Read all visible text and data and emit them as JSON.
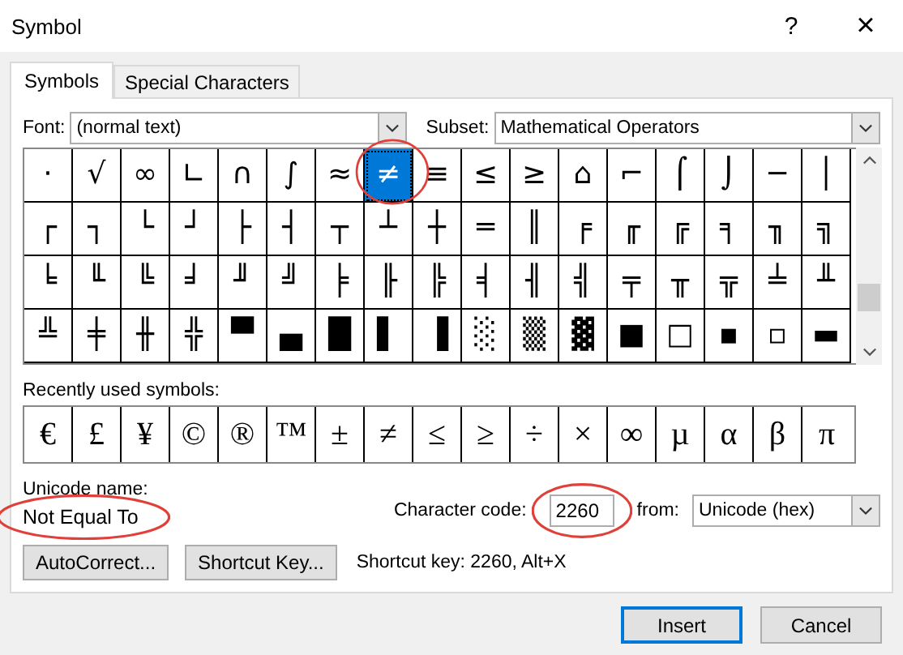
{
  "window": {
    "title": "Symbol",
    "help_button": "?",
    "close_button": "×"
  },
  "tabs": [
    {
      "label": "Symbols",
      "selected": true
    },
    {
      "label": "Special Characters",
      "selected": false
    }
  ],
  "font": {
    "label": "Font:",
    "value": "(normal text)"
  },
  "subset": {
    "label": "Subset:",
    "value": "Mathematical Operators"
  },
  "symbol_grid": [
    [
      {
        "char": "·",
        "selected": false
      },
      {
        "char": "√",
        "selected": false
      },
      {
        "char": "∞",
        "selected": false
      },
      {
        "char": "∟",
        "selected": false
      },
      {
        "char": "∩",
        "selected": false
      },
      {
        "char": "∫",
        "selected": false
      },
      {
        "char": "≈",
        "selected": false
      },
      {
        "char": "≠",
        "selected": true
      },
      {
        "char": "≡",
        "selected": false
      },
      {
        "char": "≤",
        "selected": false
      },
      {
        "char": "≥",
        "selected": false
      },
      {
        "char": "⌂",
        "selected": false
      },
      {
        "char": "⌐",
        "selected": false
      },
      {
        "char": "⌠",
        "selected": false
      },
      {
        "char": "⌡",
        "selected": false
      },
      {
        "char": "─",
        "selected": false
      },
      {
        "char": "│",
        "selected": false
      }
    ],
    [
      {
        "char": "┌",
        "selected": false
      },
      {
        "char": "┐",
        "selected": false
      },
      {
        "char": "└",
        "selected": false
      },
      {
        "char": "┘",
        "selected": false
      },
      {
        "char": "├",
        "selected": false
      },
      {
        "char": "┤",
        "selected": false
      },
      {
        "char": "┬",
        "selected": false
      },
      {
        "char": "┴",
        "selected": false
      },
      {
        "char": "┼",
        "selected": false
      },
      {
        "char": "═",
        "selected": false
      },
      {
        "char": "║",
        "selected": false
      },
      {
        "char": "╒",
        "selected": false
      },
      {
        "char": "╓",
        "selected": false
      },
      {
        "char": "╔",
        "selected": false
      },
      {
        "char": "╕",
        "selected": false
      },
      {
        "char": "╖",
        "selected": false
      },
      {
        "char": "╗",
        "selected": false
      }
    ],
    [
      {
        "char": "╘",
        "selected": false
      },
      {
        "char": "╙",
        "selected": false
      },
      {
        "char": "╚",
        "selected": false
      },
      {
        "char": "╛",
        "selected": false
      },
      {
        "char": "╜",
        "selected": false
      },
      {
        "char": "╝",
        "selected": false
      },
      {
        "char": "╞",
        "selected": false
      },
      {
        "char": "╟",
        "selected": false
      },
      {
        "char": "╠",
        "selected": false
      },
      {
        "char": "╡",
        "selected": false
      },
      {
        "char": "╢",
        "selected": false
      },
      {
        "char": "╣",
        "selected": false
      },
      {
        "char": "╤",
        "selected": false
      },
      {
        "char": "╥",
        "selected": false
      },
      {
        "char": "╦",
        "selected": false
      },
      {
        "char": "╧",
        "selected": false
      },
      {
        "char": "╨",
        "selected": false
      }
    ],
    [
      {
        "char": "╩",
        "selected": false
      },
      {
        "char": "╪",
        "selected": false
      },
      {
        "char": "╫",
        "selected": false
      },
      {
        "char": "╬",
        "selected": false
      },
      {
        "char": "▀",
        "selected": false
      },
      {
        "char": "▄",
        "selected": false
      },
      {
        "char": "█",
        "selected": false
      },
      {
        "char": "▌",
        "selected": false
      },
      {
        "char": "▐",
        "selected": false
      },
      {
        "char": "░",
        "selected": false
      },
      {
        "char": "▒",
        "selected": false
      },
      {
        "char": "▓",
        "selected": false
      },
      {
        "char": "■",
        "selected": false
      },
      {
        "char": "□",
        "selected": false
      },
      {
        "char": "▪",
        "selected": false
      },
      {
        "char": "▫",
        "selected": false
      },
      {
        "char": "▬",
        "selected": false
      }
    ]
  ],
  "recent": {
    "label": "Recently used symbols:",
    "symbols": [
      "€",
      "£",
      "¥",
      "©",
      "®",
      "™",
      "±",
      "≠",
      "≤",
      "≥",
      "÷",
      "×",
      "∞",
      "µ",
      "α",
      "β",
      "π"
    ]
  },
  "unicode_name": {
    "label": "Unicode name:",
    "value": "Not Equal To"
  },
  "character_code": {
    "label": "Character code:",
    "value": "2260"
  },
  "from": {
    "label": "from:",
    "value": "Unicode (hex)"
  },
  "autocorrect_button": "AutoCorrect...",
  "shortcut_key_button": "Shortcut Key...",
  "shortcut_key_text": "Shortcut key: 2260, Alt+X",
  "buttons": [
    {
      "label": "Insert",
      "default": true
    },
    {
      "label": "Cancel",
      "default": false
    }
  ]
}
